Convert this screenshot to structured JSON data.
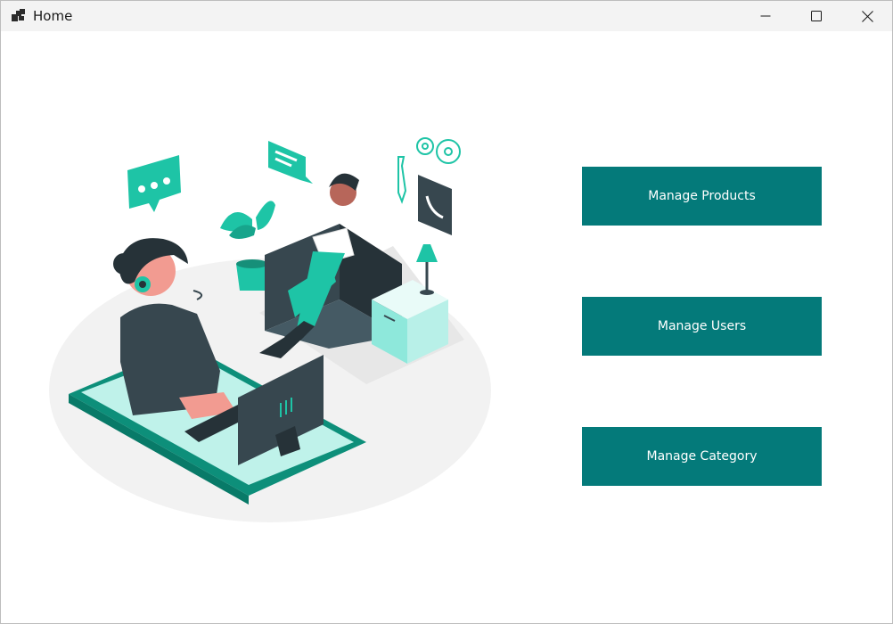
{
  "window": {
    "title": "Home",
    "app_icon": "windows-forms-app-icon",
    "controls": {
      "minimize_icon": "minimize-icon",
      "maximize_icon": "maximize-icon",
      "close_icon": "close-icon"
    }
  },
  "illustration": {
    "name": "customer-support-illustration"
  },
  "actions": {
    "manage_products": "Manage Products",
    "manage_users": "Manage Users",
    "manage_category": "Manage Category"
  },
  "colors": {
    "button_bg": "#047a7a",
    "button_text": "#ffffff",
    "accent_teal": "#1ec4a6",
    "titlebar_bg": "#f3f3f3"
  }
}
